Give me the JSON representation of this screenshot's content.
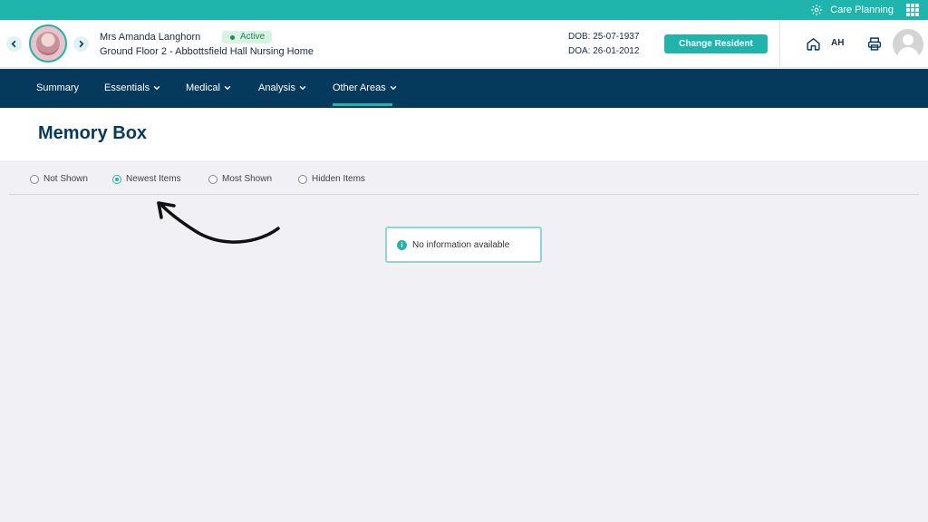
{
  "app": {
    "name": "Care Planning"
  },
  "resident": {
    "name": "Mrs Amanda Langhorn",
    "status": "Active",
    "location": "Ground Floor 2 - Abbottsfield Hall Nursing Home",
    "dob": "DOB: 25-07-1937",
    "doa": "DOA: 26-01-2012"
  },
  "header": {
    "change_button": "Change Resident",
    "user_initials": "AH"
  },
  "nav": {
    "items": [
      {
        "label": "Summary",
        "has_dropdown": false
      },
      {
        "label": "Essentials",
        "has_dropdown": true
      },
      {
        "label": "Medical",
        "has_dropdown": true
      },
      {
        "label": "Analysis",
        "has_dropdown": true
      },
      {
        "label": "Other Areas",
        "has_dropdown": true,
        "active": true
      }
    ]
  },
  "page": {
    "title": "Memory Box"
  },
  "filters": {
    "options": [
      {
        "label": "Not Shown",
        "checked": false
      },
      {
        "label": "Newest Items",
        "checked": true
      },
      {
        "label": "Most Shown",
        "checked": false
      },
      {
        "label": "Hidden Items",
        "checked": false
      }
    ]
  },
  "message": {
    "text": "No information available"
  },
  "colors": {
    "accent": "#1fb5ad",
    "navbar": "#063a5c",
    "background": "#f0f0f5"
  },
  "icons": [
    "gear-icon",
    "apps-grid-icon",
    "chevron-left-icon",
    "chevron-right-icon",
    "home-icon",
    "printer-icon",
    "user-avatar-icon",
    "chevron-down-icon",
    "info-icon"
  ]
}
